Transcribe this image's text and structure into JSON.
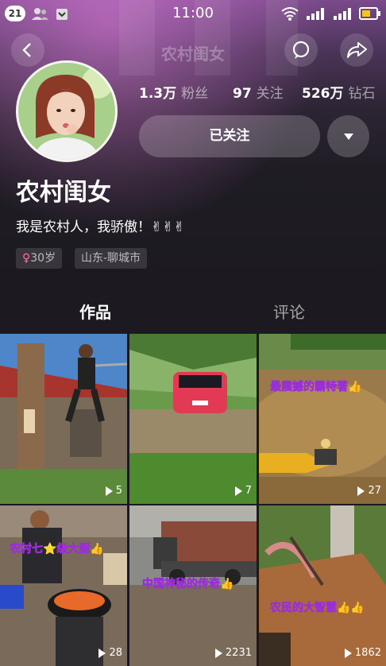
{
  "status_bar": {
    "notification_count": "21",
    "time": "11:00"
  },
  "nav": {
    "title": "农村闺女"
  },
  "stats": {
    "fans_num": "1.3万",
    "fans_label": "粉丝",
    "follow_num": "97",
    "follow_label": "关注",
    "diamond_num": "526万",
    "diamond_label": "钻石"
  },
  "profile": {
    "follow_button_label": "已关注",
    "name": "农村闺女",
    "bio": "我是农村人，我骄傲！✌✌✌",
    "gender_symbol": "♀",
    "age": "30岁",
    "location": "山东-聊城市"
  },
  "tabs": {
    "works": "作品",
    "comments": "评论"
  },
  "videos": [
    {
      "overlay": "",
      "plays": "5"
    },
    {
      "overlay": "",
      "plays": "7"
    },
    {
      "overlay": "最震撼的霸特著👍",
      "plays": "27"
    },
    {
      "overlay": "农村七⭐级大厨👍",
      "plays": "28"
    },
    {
      "overlay": "中国神秘的传奇👍",
      "plays": "2231"
    },
    {
      "overlay": "农民的大智慧👍👍",
      "plays": "1862"
    }
  ],
  "colors": {
    "accent_overlay_text": "#e8b8ff",
    "overlay_stroke": "#9b2fd6",
    "background": "#1c1a20"
  }
}
